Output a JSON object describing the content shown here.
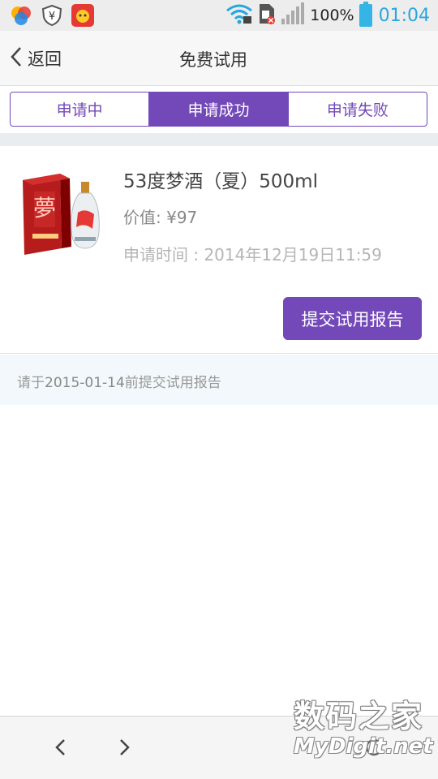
{
  "status_bar": {
    "battery_percent": "100%",
    "time": "01:04",
    "icons": [
      "app-icon-colorful",
      "shield-yen-icon",
      "red-app-icon",
      "wifi-icon",
      "sim-card-icon",
      "signal-icon",
      "battery-icon"
    ],
    "time_color": "#2aa6df"
  },
  "header": {
    "back_label": "返回",
    "title": "免费试用"
  },
  "tabs": [
    {
      "label": "申请中",
      "active": false
    },
    {
      "label": "申请成功",
      "active": true
    },
    {
      "label": "申请失败",
      "active": false
    }
  ],
  "product": {
    "name": "53度梦酒（夏）500ml",
    "price": "价值: ¥97",
    "apply_time": "申请时间 : 2014年12月19日11:59",
    "image": "red-wine-box-and-bottle"
  },
  "actions": {
    "submit_label": "提交试用报告"
  },
  "deadline": {
    "prefix": "请于",
    "date": "2015-01-14",
    "suffix": "前提交试用报告"
  },
  "watermark": {
    "line1": "数码之家",
    "line2": "MyDigit.net"
  },
  "colors": {
    "accent": "#7348b8"
  }
}
